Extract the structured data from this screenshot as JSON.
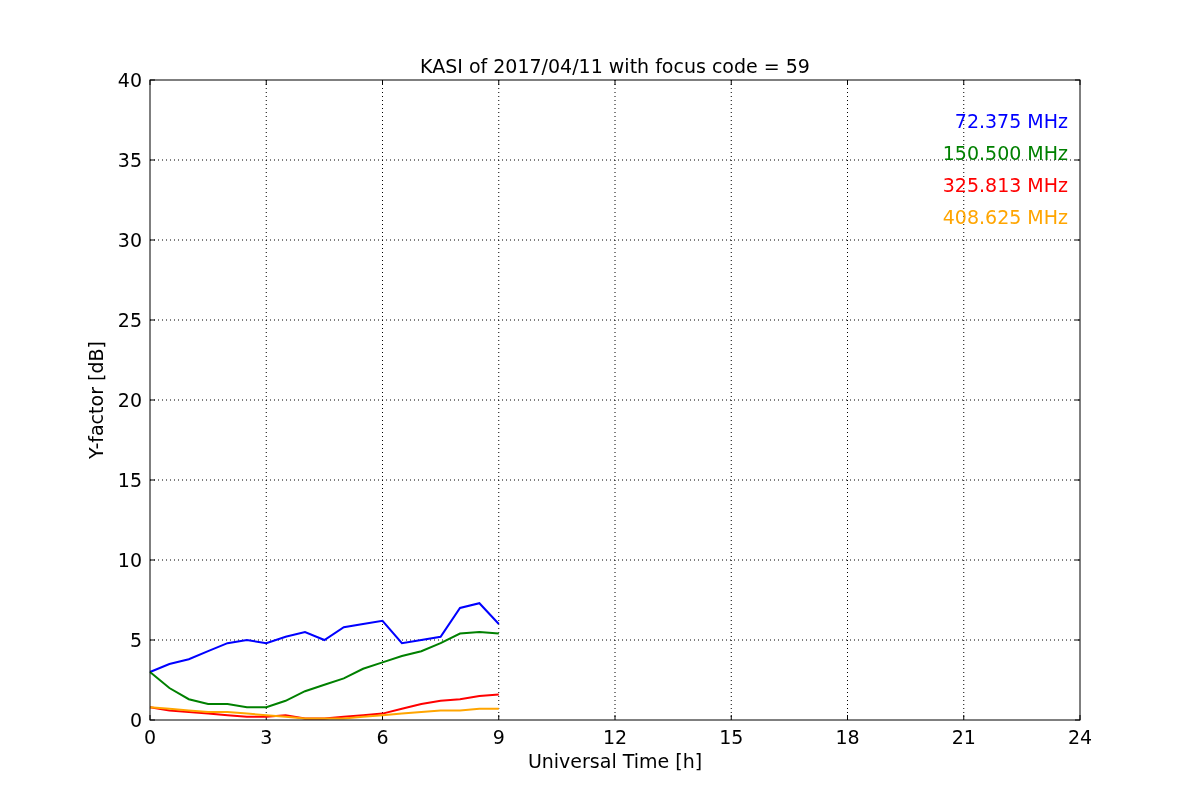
{
  "chart_data": {
    "type": "line",
    "title": "KASI of 2017/04/11 with focus code = 59",
    "xlabel": "Universal Time [h]",
    "ylabel": "Y-factor [dB]",
    "x": [
      0,
      0.5,
      1,
      1.5,
      2,
      2.5,
      3,
      3.5,
      4,
      4.5,
      5,
      5.5,
      6,
      6.5,
      7,
      7.5,
      8,
      8.5,
      9
    ],
    "series": [
      {
        "name": "72.375 MHz",
        "color": "#0000ff",
        "values": [
          3,
          3.5,
          3.8,
          4.3,
          4.8,
          5,
          4.8,
          5.2,
          5.5,
          5,
          5.8,
          6,
          6.2,
          4.8,
          5,
          5.2,
          7,
          7.3,
          6
        ]
      },
      {
        "name": "150.500 MHz",
        "color": "#008000",
        "values": [
          3,
          2,
          1.3,
          1,
          1,
          0.8,
          0.8,
          1.2,
          1.8,
          2.2,
          2.6,
          3.2,
          3.6,
          4,
          4.3,
          4.8,
          5.4,
          5.5,
          5.4
        ]
      },
      {
        "name": "325.813 MHz",
        "color": "#ff0000",
        "values": [
          0.8,
          0.6,
          0.5,
          0.4,
          0.3,
          0.2,
          0.2,
          0.3,
          0.1,
          0.1,
          0.2,
          0.3,
          0.4,
          0.7,
          1,
          1.2,
          1.3,
          1.5,
          1.6
        ]
      },
      {
        "name": "408.625 MHz",
        "color": "#ffa500",
        "values": [
          0.8,
          0.7,
          0.6,
          0.5,
          0.5,
          0.4,
          0.3,
          0.2,
          0.1,
          0.1,
          0.1,
          0.2,
          0.3,
          0.4,
          0.5,
          0.6,
          0.6,
          0.7,
          0.7
        ]
      }
    ],
    "grid": true,
    "xlim": [
      0,
      24
    ],
    "ylim": [
      0,
      40
    ],
    "xticks": [
      0,
      3,
      6,
      9,
      12,
      15,
      18,
      21,
      24
    ],
    "yticks": [
      0,
      5,
      10,
      15,
      20,
      25,
      30,
      35,
      40
    ]
  }
}
